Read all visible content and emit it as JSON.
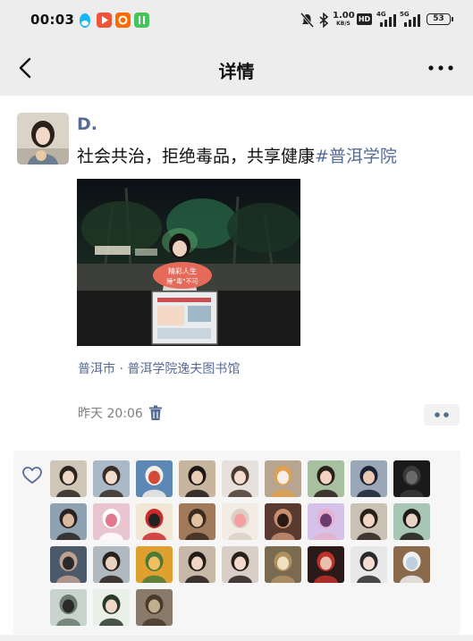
{
  "status_bar": {
    "time": "00:03",
    "app_icons": [
      "qq-penguin-icon",
      "video-play-icon",
      "taobao-icon",
      "wechat-mini-icon"
    ],
    "net_speed_value": "1.00",
    "net_speed_unit": "KB/S",
    "hd_label": "HD",
    "signal1_label": "4G",
    "signal2_label": "5G",
    "battery": "53"
  },
  "nav": {
    "title": "详情",
    "back_icon": "chevron-left-icon",
    "more_icon": "more-dots-icon"
  },
  "post": {
    "username": "D.",
    "text": "社会共治，拒绝毒品，共享健康",
    "hashtag": "#普洱学院",
    "photo_sign_line1": "精彩人生",
    "photo_sign_line2": "睡“毒”不可",
    "location": "普洱市 · 普洱学院逸夫图书馆",
    "time": "昨天 20:06"
  },
  "likes": {
    "count_avatars": 30
  },
  "colors": {
    "link": "#576b95",
    "nav_bg": "#ededed",
    "likes_bg": "#f6f6f6",
    "meta_gray": "#7f7f7f"
  }
}
